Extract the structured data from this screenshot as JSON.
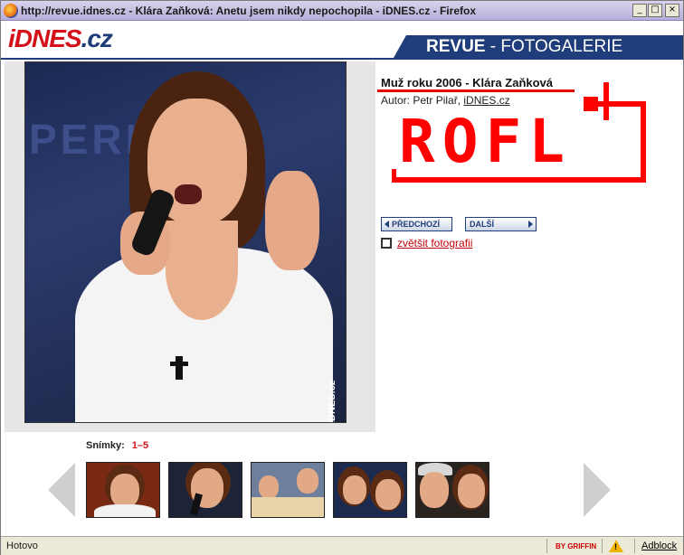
{
  "window": {
    "title": "http://revue.idnes.cz - Klára Zaňková: Anetu jsem nikdy nepochopila - iDNES.cz - Firefox",
    "minimize_glyph": "_",
    "maximize_glyph": "□",
    "close_glyph": "×"
  },
  "header": {
    "logo_part1": "iDNES",
    "logo_part2": ".cz",
    "section_bold": "REVUE",
    "section_sep": " - ",
    "section_rest": "FOTOGALERIE"
  },
  "photo": {
    "background_text": "PERI   KU",
    "watermark": "iDNES.cz"
  },
  "info": {
    "title": "Muž roku 2006 - Klára Zaňková",
    "author_prefix": "Autor: Petr Pilař, ",
    "author_link": "iDNES.cz"
  },
  "graffiti": {
    "text": "ROFL",
    "color": "#ff0000"
  },
  "nav": {
    "prev_label": "PŘEDCHOZÍ",
    "next_label": "DALŠÍ",
    "zoom_label": "zvětšit fotografii"
  },
  "thumbnails": {
    "label": "Snímky:",
    "range": "1–5",
    "items": [
      {
        "name": "thumb-1"
      },
      {
        "name": "thumb-2"
      },
      {
        "name": "thumb-3"
      },
      {
        "name": "thumb-4"
      },
      {
        "name": "thumb-5"
      }
    ]
  },
  "statusbar": {
    "status": "Hotovo",
    "griffin": "BY GRIFFIN",
    "warning_glyph": "!",
    "adblock": "Adblock"
  },
  "colors": {
    "brand_blue": "#1f3d7a",
    "brand_red": "#d4111a"
  }
}
